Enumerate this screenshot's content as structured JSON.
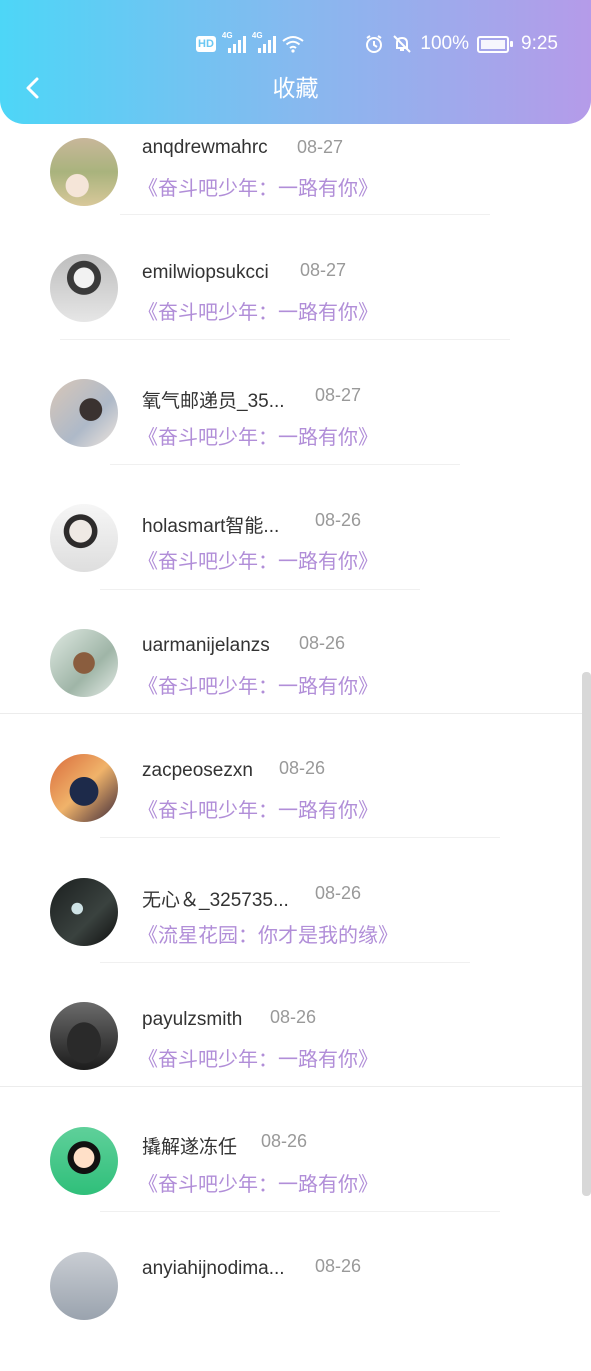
{
  "status_bar": {
    "battery_percent": "100%",
    "time": "9:25",
    "hd_label": "HD",
    "network_1": "4G",
    "network_2": "4G"
  },
  "nav": {
    "title": "收藏"
  },
  "items": [
    {
      "name": "anqdrewmahrc",
      "date": "08-27",
      "work": "《奋斗吧少年：一路有你》"
    },
    {
      "name": "emilwiopsukcci",
      "date": "08-27",
      "work": "《奋斗吧少年：一路有你》"
    },
    {
      "name": "氧气邮递员_35...",
      "date": "08-27",
      "work": "《奋斗吧少年：一路有你》"
    },
    {
      "name": "holasmart智能...",
      "date": "08-26",
      "work": "《奋斗吧少年：一路有你》"
    },
    {
      "name": "uarmanijelanzs",
      "date": "08-26",
      "work": "《奋斗吧少年：一路有你》"
    },
    {
      "name": "zacpeosezxn",
      "date": "08-26",
      "work": "《奋斗吧少年：一路有你》"
    },
    {
      "name": "无心＆_325735...",
      "date": "08-26",
      "work": "《流星花园：你才是我的缘》"
    },
    {
      "name": "payulzsmith",
      "date": "08-26",
      "work": "《奋斗吧少年：一路有你》"
    },
    {
      "name": "撬解遂冻任",
      "date": "08-26",
      "work": "《奋斗吧少年：一路有你》"
    },
    {
      "name": "anyiahijnodima...",
      "date": "08-26",
      "work": ""
    }
  ],
  "colors": {
    "header_start": "#4dd6f7",
    "header_end": "#b59be9",
    "work_title": "#b18ed8"
  }
}
